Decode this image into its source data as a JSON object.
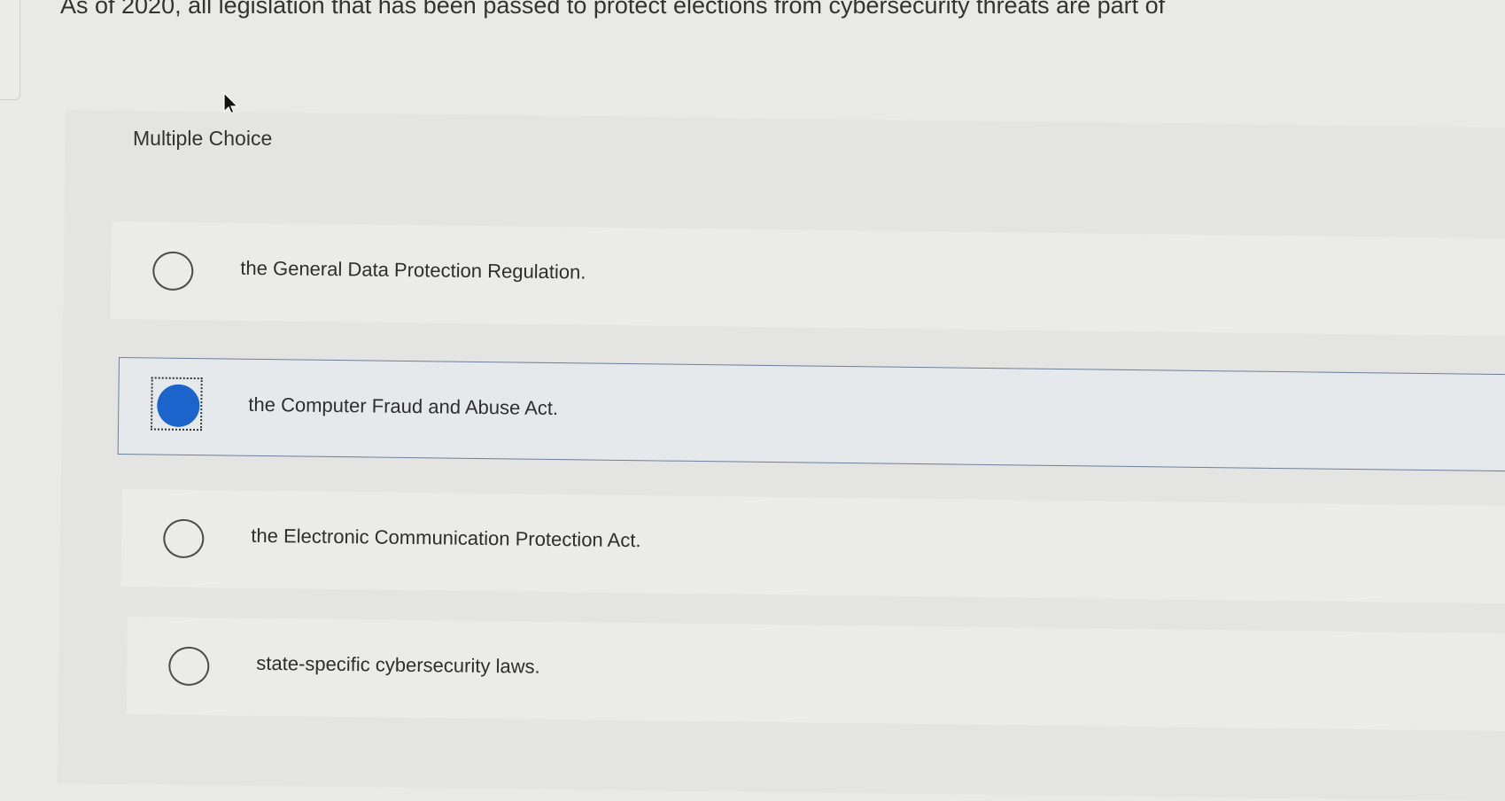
{
  "question": {
    "text": "As of 2020, all legislation that has been passed to protect elections from cybersecurity threats are part of"
  },
  "section_label": "Multiple Choice",
  "options": [
    {
      "label": "the General Data Protection Regulation.",
      "selected": false
    },
    {
      "label": "the Computer Fraud and Abuse Act.",
      "selected": true
    },
    {
      "label": "the Electronic Communication Protection Act.",
      "selected": false
    },
    {
      "label": "state-specific cybersecurity laws.",
      "selected": false
    }
  ],
  "colors": {
    "selected_radio": "#1a64cc",
    "selected_border": "#6d7f9b",
    "background": "#e9e9e7"
  },
  "icons": {
    "cursor": "mouse-pointer-icon"
  }
}
